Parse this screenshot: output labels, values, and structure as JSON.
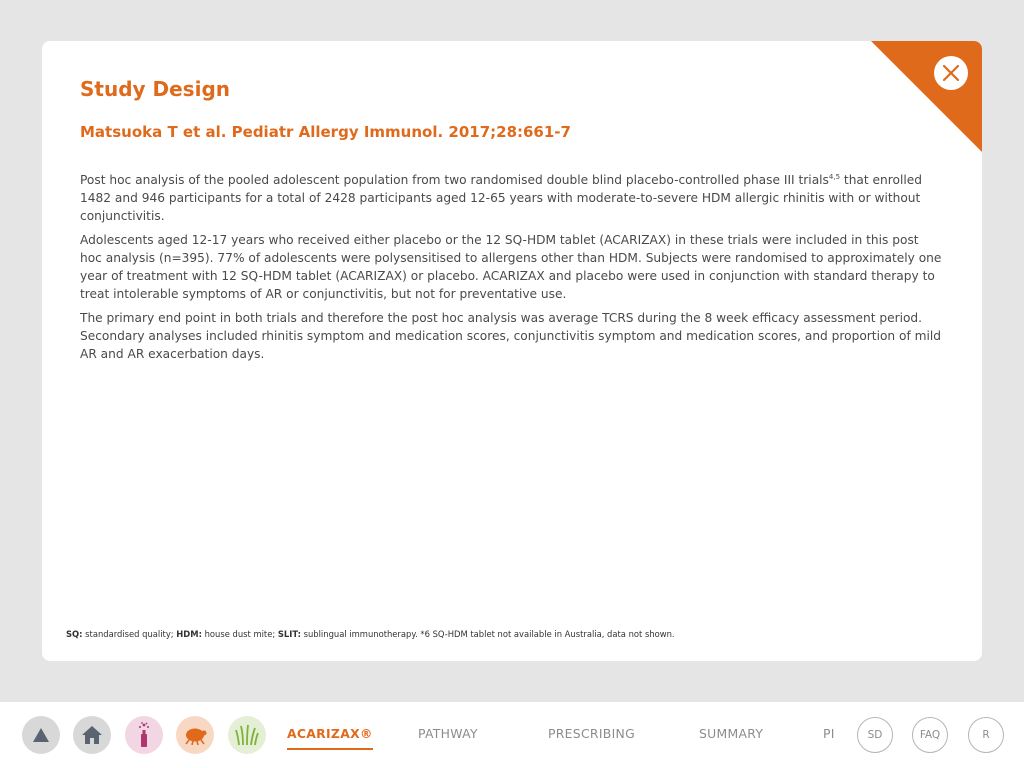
{
  "modal": {
    "title": "Study Design",
    "citation": "Matsuoka T et al. Pediatr Allergy Immunol. 2017;28:661-7",
    "paragraphs": [
      {
        "before_sup": "Post hoc analysis of the pooled adolescent population from two randomised double blind placebo-controlled phase III trials",
        "sup": "4,5",
        "after_sup": " that enrolled 1482 and 946 participants for a total of 2428 participants aged 12-65 years with moderate-to-severe HDM allergic rhinitis with or without conjunctivitis."
      },
      {
        "text": "Adolescents aged 12-17 years who received either placebo or the 12 SQ-HDM tablet (ACARIZAX) in these trials were included in this post hoc analysis (n=395). 77% of adolescents were polysensitised to allergens other than HDM. Subjects were randomised to approximately one year of treatment with 12 SQ-HDM tablet (ACARIZAX) or placebo. ACARIZAX and placebo were used in conjunction with standard therapy to treat intolerable symptoms of AR or conjunctivitis, but not for preventative use."
      },
      {
        "text": "The primary end point in both trials and therefore the post hoc analysis was average TCRS during the 8 week efficacy assessment period. Secondary analyses included rhinitis symptom and medication scores, conjunctivitis symptom and medication scores, and proportion of mild AR and AR exacerbation days."
      }
    ],
    "footnote": {
      "sq_term": "SQ:",
      "sq_def": " standardised quality; ",
      "hdm_term": "HDM:",
      "hdm_def": " house dust mite; ",
      "slit_term": "SLIT:",
      "slit_def": " sublingual immunotherapy. *6 SQ-HDM tablet not available in Australia, data not shown."
    },
    "close_icon": "close-icon",
    "accent_color": "#e06a1c"
  },
  "nav": {
    "icon_buttons": [
      {
        "icon": "triangle-up-icon",
        "bg": "#d8d8d8"
      },
      {
        "icon": "home-icon",
        "bg": "#d8d8d8"
      },
      {
        "icon": "tree-pollen-icon",
        "bg": "#f3d6e3"
      },
      {
        "icon": "dust-mite-icon",
        "bg": "#f8d8c2"
      },
      {
        "icon": "grass-icon",
        "bg": "#e4efd6"
      }
    ],
    "links": [
      "ACARIZAX®",
      "PATHWAY",
      "PRESCRIBING",
      "SUMMARY",
      "PI"
    ],
    "active_link": "ACARIZAX®",
    "circle_buttons": [
      "SD",
      "FAQ",
      "R"
    ]
  }
}
